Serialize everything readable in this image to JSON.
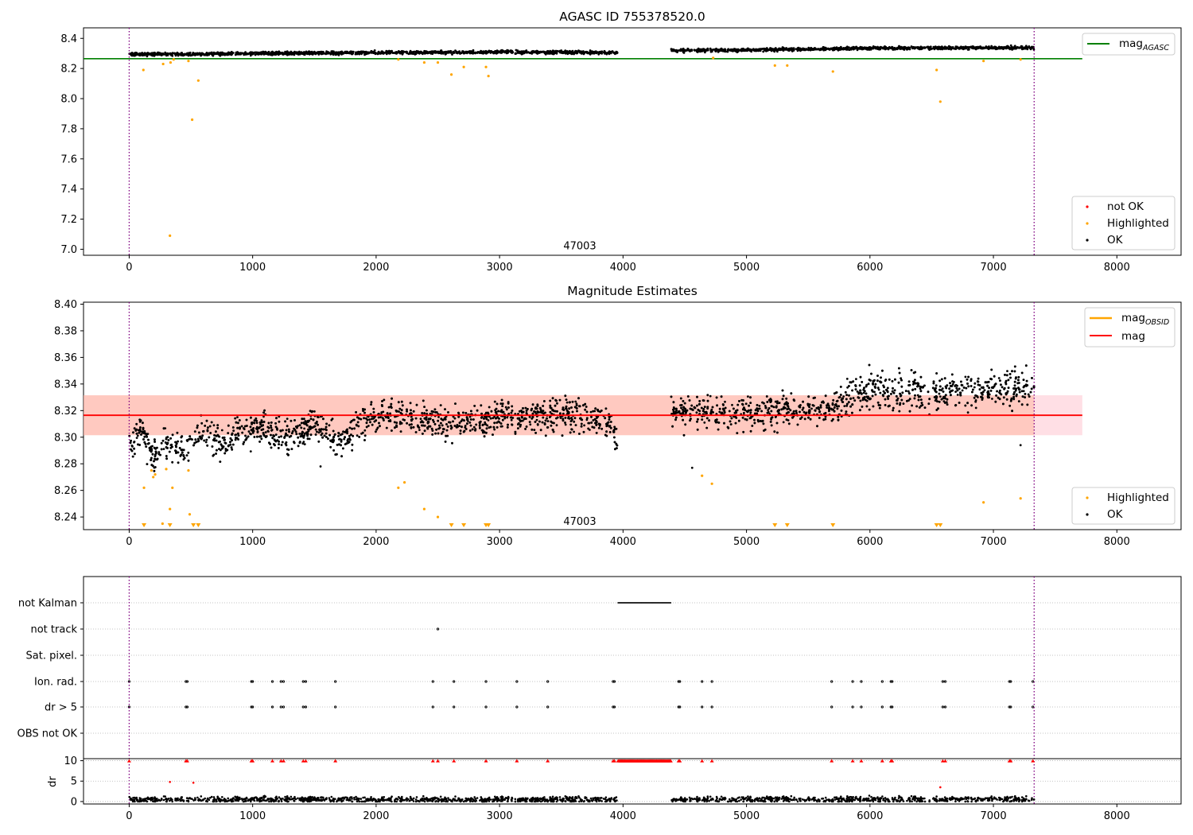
{
  "colors": {
    "ok": "#000000",
    "highlighted": "#ffa500",
    "not_ok": "#ff0000",
    "mag_agasc": "#008000",
    "mag_obsid": "#ffa500",
    "mag": "#ff0000",
    "band_pink": "#ffc0cb",
    "band_orange": "#ffa07a",
    "interval_line": "#800080",
    "grid": "#b0b0b0",
    "fill_dark": "#2a1000"
  },
  "chart_data": [
    {
      "type": "scatter",
      "title": "AGASC ID 755378520.0",
      "xlim": [
        -370,
        8520
      ],
      "ylim": [
        6.96,
        8.47
      ],
      "x_ticks": [
        0,
        1000,
        2000,
        3000,
        4000,
        5000,
        6000,
        7000,
        8000
      ],
      "y_ticks": [
        7.0,
        7.2,
        7.4,
        7.6,
        7.8,
        8.0,
        8.2,
        8.4
      ],
      "y_tick_labels": [
        "7.0",
        "7.2",
        "7.4",
        "7.6",
        "7.8",
        "8.0",
        "8.2",
        "8.4"
      ],
      "annotation": {
        "text": "47003",
        "x": 3650,
        "y": 7.02
      },
      "interval_lines": [
        0,
        7330
      ],
      "reference_line": {
        "name": "mag",
        "subscript": "AGASC",
        "y": 8.265,
        "x_range": [
          -370,
          7720
        ]
      },
      "legend_top": [
        {
          "label": "mag",
          "subscript": "AGASC",
          "kind": "line",
          "color_key": "mag_agasc"
        }
      ],
      "legend_bottom": [
        {
          "label": "not OK",
          "kind": "dot",
          "color_key": "not_ok"
        },
        {
          "label": "Highlighted",
          "kind": "dot",
          "color_key": "highlighted"
        },
        {
          "label": "OK",
          "kind": "dot",
          "color_key": "ok"
        }
      ],
      "ok_trend": [
        {
          "x": 0,
          "y": 8.295
        },
        {
          "x": 500,
          "y": 8.295
        },
        {
          "x": 1000,
          "y": 8.3
        },
        {
          "x": 2000,
          "y": 8.305
        },
        {
          "x": 3000,
          "y": 8.31
        },
        {
          "x": 3960,
          "y": 8.305
        },
        {
          "x": 4390,
          "y": 8.32
        },
        {
          "x": 5000,
          "y": 8.322
        },
        {
          "x": 6000,
          "y": 8.335
        },
        {
          "x": 7330,
          "y": 8.338
        }
      ],
      "ok_spread": 0.015,
      "ok_gap": [
        3960,
        4390
      ],
      "highlighted": [
        {
          "x": 115,
          "y": 8.19
        },
        {
          "x": 275,
          "y": 8.23
        },
        {
          "x": 330,
          "y": 7.09
        },
        {
          "x": 335,
          "y": 8.24
        },
        {
          "x": 360,
          "y": 8.26
        },
        {
          "x": 480,
          "y": 8.25
        },
        {
          "x": 510,
          "y": 7.86
        },
        {
          "x": 560,
          "y": 8.12
        },
        {
          "x": 2180,
          "y": 8.26
        },
        {
          "x": 2390,
          "y": 8.24
        },
        {
          "x": 2500,
          "y": 8.24
        },
        {
          "x": 2610,
          "y": 8.16
        },
        {
          "x": 2710,
          "y": 8.21
        },
        {
          "x": 2890,
          "y": 8.21
        },
        {
          "x": 2910,
          "y": 8.15
        },
        {
          "x": 4730,
          "y": 8.27
        },
        {
          "x": 5230,
          "y": 8.22
        },
        {
          "x": 5330,
          "y": 8.22
        },
        {
          "x": 5700,
          "y": 8.18
        },
        {
          "x": 6540,
          "y": 8.19
        },
        {
          "x": 6570,
          "y": 7.98
        },
        {
          "x": 6920,
          "y": 8.25
        },
        {
          "x": 7220,
          "y": 8.26
        }
      ]
    },
    {
      "type": "scatter",
      "title": "Magnitude Estimates",
      "xlim": [
        -370,
        8520
      ],
      "ylim": [
        8.2305,
        8.4015
      ],
      "x_ticks": [
        0,
        1000,
        2000,
        3000,
        4000,
        5000,
        6000,
        7000,
        8000
      ],
      "y_ticks": [
        8.24,
        8.26,
        8.28,
        8.3,
        8.32,
        8.34,
        8.36,
        8.38,
        8.4
      ],
      "y_tick_labels": [
        "8.24",
        "8.26",
        "8.28",
        "8.30",
        "8.32",
        "8.34",
        "8.36",
        "8.38",
        "8.40"
      ],
      "annotation": {
        "text": "47003",
        "x": 3650,
        "y": 8.2365
      },
      "interval_lines": [
        0,
        7330
      ],
      "mag_line": {
        "y": 8.3165,
        "x_range": [
          -370,
          7720
        ]
      },
      "mag_band": {
        "y_low": 8.3015,
        "y_high": 8.3315,
        "x_range": [
          -370,
          7720
        ]
      },
      "mag_obsid_band": {
        "y_low": 8.3015,
        "y_high": 8.3315,
        "x_range": [
          -370,
          7330
        ]
      },
      "legend_top": [
        {
          "label": "mag",
          "subscript": "OBSID",
          "kind": "line",
          "color_key": "mag_obsid"
        },
        {
          "label": "mag",
          "kind": "line",
          "color_key": "mag"
        }
      ],
      "legend_bottom": [
        {
          "label": "Highlighted",
          "kind": "dot",
          "color_key": "highlighted"
        },
        {
          "label": "OK",
          "kind": "dot",
          "color_key": "ok"
        }
      ],
      "ok_trend": [
        {
          "x": 0,
          "y": 8.29
        },
        {
          "x": 100,
          "y": 8.31
        },
        {
          "x": 180,
          "y": 8.285
        },
        {
          "x": 300,
          "y": 8.295
        },
        {
          "x": 450,
          "y": 8.29
        },
        {
          "x": 600,
          "y": 8.305
        },
        {
          "x": 750,
          "y": 8.295
        },
        {
          "x": 900,
          "y": 8.305
        },
        {
          "x": 1100,
          "y": 8.305
        },
        {
          "x": 1300,
          "y": 8.3
        },
        {
          "x": 1500,
          "y": 8.31
        },
        {
          "x": 1750,
          "y": 8.295
        },
        {
          "x": 1850,
          "y": 8.31
        },
        {
          "x": 2050,
          "y": 8.318
        },
        {
          "x": 2500,
          "y": 8.312
        },
        {
          "x": 3000,
          "y": 8.315
        },
        {
          "x": 3500,
          "y": 8.318
        },
        {
          "x": 3900,
          "y": 8.312
        },
        {
          "x": 3960,
          "y": 8.292
        },
        {
          "x": 4390,
          "y": 8.32
        },
        {
          "x": 5000,
          "y": 8.318
        },
        {
          "x": 5300,
          "y": 8.318
        },
        {
          "x": 5750,
          "y": 8.325
        },
        {
          "x": 6000,
          "y": 8.335
        },
        {
          "x": 6500,
          "y": 8.333
        },
        {
          "x": 7000,
          "y": 8.335
        },
        {
          "x": 7330,
          "y": 8.338
        }
      ],
      "ok_spread": 0.006,
      "ok_gap": [
        3960,
        4390
      ],
      "highlighted": [
        {
          "x": 120,
          "y": 8.262
        },
        {
          "x": 180,
          "y": 8.275
        },
        {
          "x": 195,
          "y": 8.27
        },
        {
          "x": 210,
          "y": 8.272
        },
        {
          "x": 270,
          "y": 8.235
        },
        {
          "x": 300,
          "y": 8.276
        },
        {
          "x": 330,
          "y": 8.246
        },
        {
          "x": 350,
          "y": 8.262
        },
        {
          "x": 480,
          "y": 8.275
        },
        {
          "x": 490,
          "y": 8.242
        },
        {
          "x": 2180,
          "y": 8.262
        },
        {
          "x": 2230,
          "y": 8.266
        },
        {
          "x": 2390,
          "y": 8.246
        },
        {
          "x": 2500,
          "y": 8.24
        },
        {
          "x": 4640,
          "y": 8.271
        },
        {
          "x": 4720,
          "y": 8.265
        },
        {
          "x": 6920,
          "y": 8.251
        },
        {
          "x": 7220,
          "y": 8.254
        }
      ],
      "highlighted_lower_limits": [
        120,
        330,
        520,
        560,
        2610,
        2710,
        2890,
        2910,
        5230,
        5330,
        5700,
        6540,
        6570
      ],
      "ok_outliers": [
        {
          "x": 4560,
          "y": 8.277
        },
        {
          "x": 7220,
          "y": 8.294
        },
        {
          "x": 1550,
          "y": 8.278
        }
      ]
    },
    {
      "type": "scatter",
      "title": "",
      "xlim": [
        -370,
        8520
      ],
      "x_ticks": [
        0,
        1000,
        2000,
        3000,
        4000,
        5000,
        6000,
        7000,
        8000
      ],
      "interval_lines": [
        0,
        7330
      ],
      "flag_labels": [
        "not Kalman",
        "not track",
        "Sat. pixel.",
        "Ion. rad.",
        "dr > 5",
        "OBS not OK"
      ],
      "flags": {
        "not Kalman": {
          "ranges": [
            [
              3960,
              4390
            ]
          ]
        },
        "not track": {
          "points": [
            2500
          ]
        },
        "Sat. pixel.": {
          "points": []
        },
        "Ion. rad.": {
          "points": [
            0,
            460,
            470,
            990,
            1000,
            1160,
            1230,
            1250,
            1410,
            1430,
            1670,
            2460,
            2630,
            2890,
            3140,
            3390,
            3920,
            3930,
            4450,
            4460,
            4640,
            4720,
            5690,
            5860,
            5930,
            6100,
            6170,
            6180,
            6590,
            6610,
            7130,
            7140,
            7320
          ]
        },
        "dr > 5": {
          "points": [
            0,
            460,
            470,
            990,
            1000,
            1160,
            1230,
            1250,
            1410,
            1430,
            1670,
            2460,
            2630,
            2890,
            3140,
            3390,
            3920,
            3930,
            4450,
            4460,
            4640,
            4720,
            5690,
            5860,
            5930,
            6100,
            6170,
            6180,
            6590,
            6610,
            7130,
            7140,
            7320
          ]
        },
        "OBS not OK": {
          "points": []
        }
      },
      "dr": {
        "ylabel": "dr",
        "ylim": [
          -0.6,
          10.5
        ],
        "y_ticks": [
          0,
          5,
          10
        ],
        "y_tick_labels": [
          "0",
          "5",
          "10"
        ],
        "ok_level": 0.5,
        "ok_gap": [
          3960,
          4390
        ],
        "capped_markers": [
          0,
          460,
          470,
          990,
          1000,
          1160,
          1230,
          1250,
          1410,
          1430,
          1670,
          2460,
          2500,
          2630,
          2890,
          3140,
          3390,
          3920,
          3930,
          4450,
          4460,
          4640,
          4720,
          5690,
          5860,
          5930,
          6100,
          6170,
          6180,
          6590,
          6610,
          7130,
          7140,
          7320
        ],
        "not_ok_points": [
          {
            "x": 330,
            "y": 4.8
          },
          {
            "x": 520,
            "y": 4.6
          },
          {
            "x": 6570,
            "y": 3.5
          }
        ]
      }
    }
  ]
}
